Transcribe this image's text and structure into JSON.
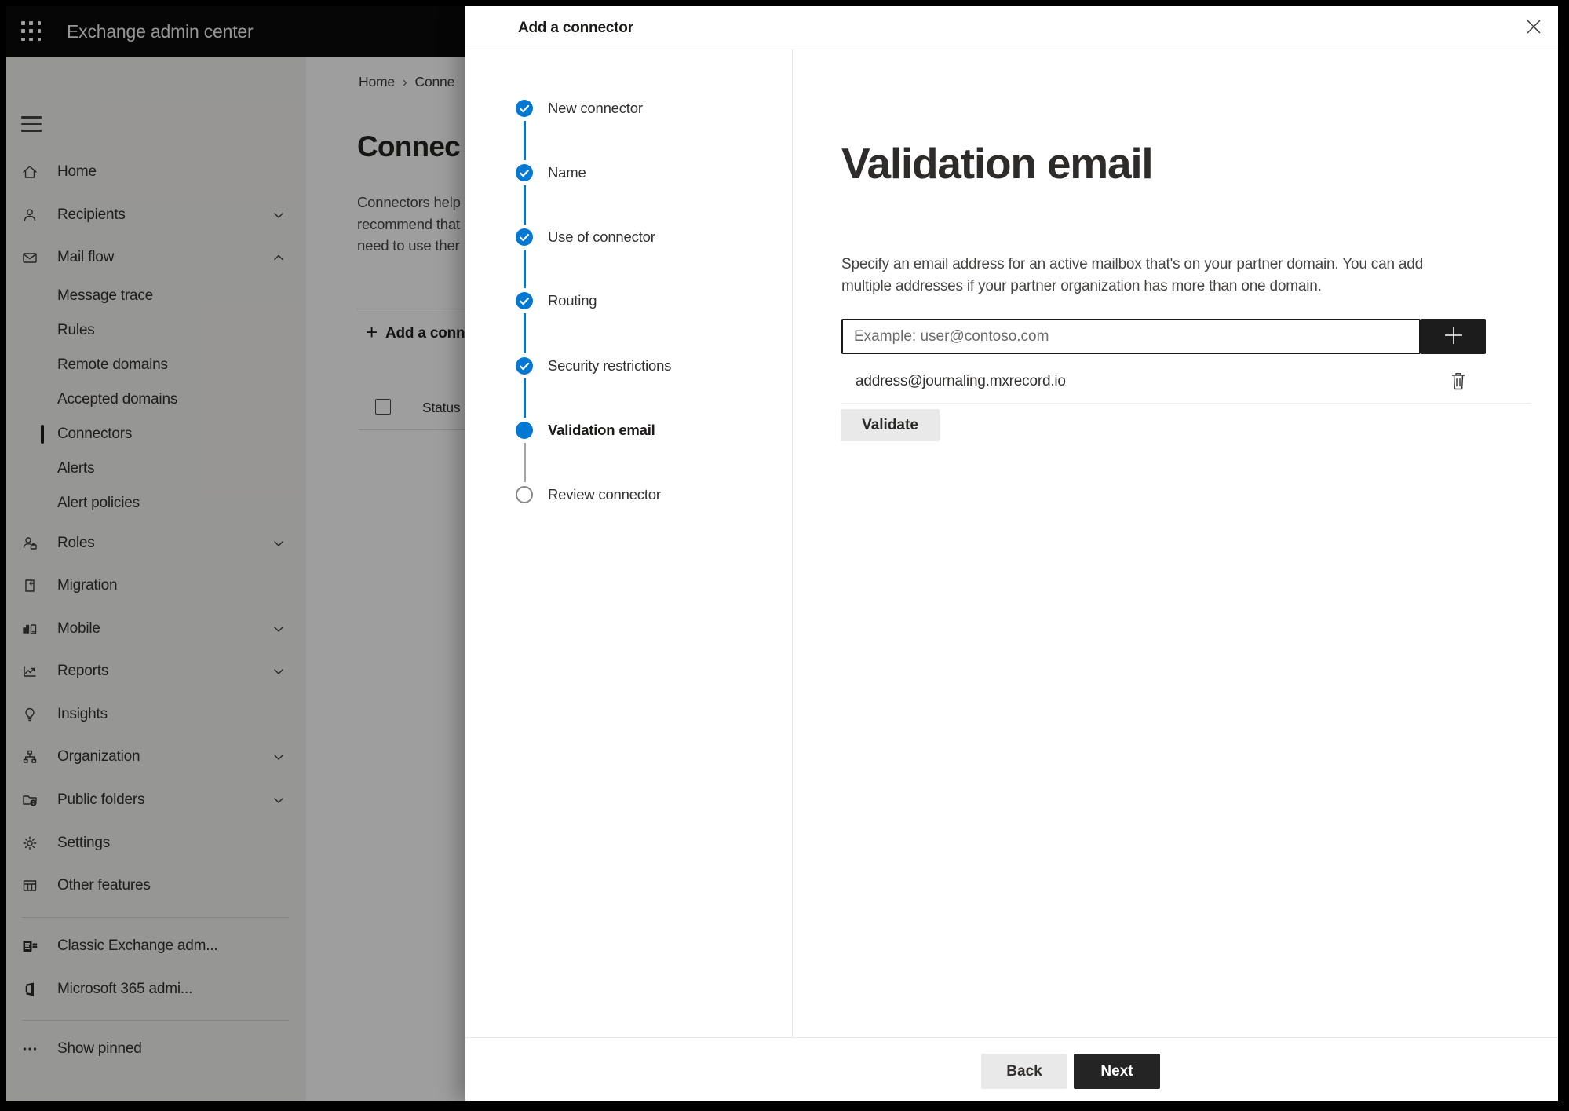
{
  "app": {
    "title": "Exchange admin center"
  },
  "breadcrumb": {
    "home": "Home",
    "separator": "›",
    "current": "Conne"
  },
  "background_page": {
    "title": "Connec",
    "description": "Connectors help\nrecommend that\nneed to use ther",
    "add_connector_button": "Add a conn",
    "table": {
      "status_header": "Status"
    }
  },
  "sidebar": {
    "items": [
      {
        "label": "Home",
        "icon": "home-icon"
      },
      {
        "label": "Recipients",
        "icon": "person-icon",
        "chevron": "down"
      },
      {
        "label": "Mail flow",
        "icon": "mail-icon",
        "chevron": "up",
        "expanded": true
      },
      {
        "label": "Message trace",
        "sub": true
      },
      {
        "label": "Rules",
        "sub": true
      },
      {
        "label": "Remote domains",
        "sub": true
      },
      {
        "label": "Accepted domains",
        "sub": true
      },
      {
        "label": "Connectors",
        "sub": true,
        "selected": true
      },
      {
        "label": "Alerts",
        "sub": true
      },
      {
        "label": "Alert policies",
        "sub": true
      },
      {
        "label": "Roles",
        "icon": "roles-icon",
        "chevron": "down"
      },
      {
        "label": "Migration",
        "icon": "migration-icon"
      },
      {
        "label": "Mobile",
        "icon": "mobile-icon",
        "chevron": "down"
      },
      {
        "label": "Reports",
        "icon": "reports-icon",
        "chevron": "down"
      },
      {
        "label": "Insights",
        "icon": "lightbulb-icon"
      },
      {
        "label": "Organization",
        "icon": "org-icon",
        "chevron": "down"
      },
      {
        "label": "Public folders",
        "icon": "folder-globe-icon",
        "chevron": "down"
      },
      {
        "label": "Settings",
        "icon": "gear-icon"
      },
      {
        "label": "Other features",
        "icon": "grid-icon"
      },
      {
        "label": "Classic Exchange adm...",
        "icon": "exchange-logo-icon"
      },
      {
        "label": "Microsoft 365 admi...",
        "icon": "office-logo-icon"
      },
      {
        "label": "Show pinned",
        "icon": "ellipsis-icon"
      }
    ]
  },
  "panel": {
    "title": "Add a connector",
    "close_icon": "close-x",
    "steps": [
      {
        "label": "New connector",
        "state": "completed"
      },
      {
        "label": "Name",
        "state": "completed"
      },
      {
        "label": "Use of connector",
        "state": "completed"
      },
      {
        "label": "Routing",
        "state": "completed"
      },
      {
        "label": "Security restrictions",
        "state": "completed"
      },
      {
        "label": "Validation email",
        "state": "current"
      },
      {
        "label": "Review connector",
        "state": "upcoming"
      }
    ],
    "content": {
      "title": "Validation email",
      "description": "Specify an email address for an active mailbox that's on your partner domain. You can add\nmultiple addresses if your partner organization has more than one domain.",
      "email_input_placeholder": "Example: user@contoso.com",
      "add_address_icon": "plus-icon",
      "added_address": "address@journaling.mxrecord.io",
      "delete_icon": "trash-icon",
      "validate_button": "Validate"
    },
    "footer": {
      "back_button": "Back",
      "next_button": "Next"
    }
  },
  "colors": {
    "accent_blue": "#0078d4",
    "step_pending_gray": "#8a8886",
    "dark_button": "#242424",
    "light_button": "#e9e9e9",
    "topbar_black": "#0a0a0a"
  }
}
